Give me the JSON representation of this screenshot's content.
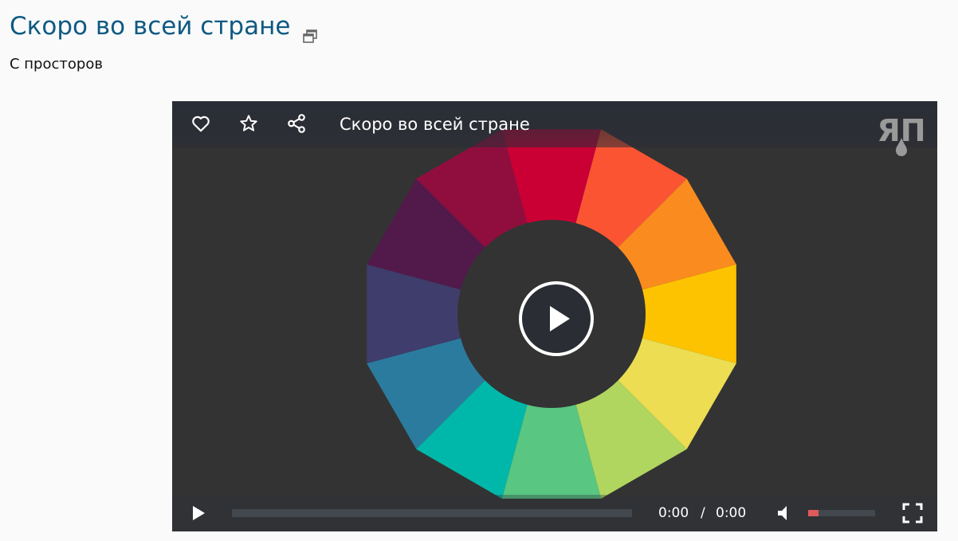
{
  "page": {
    "title": "Скоро во всей стране",
    "subtitle": "С просторов",
    "popout_icon": "popout-window-icon"
  },
  "player": {
    "title": "Скоро во всей стране",
    "logo_text": "ЯП",
    "top_icons": [
      "heart-icon",
      "star-icon",
      "share-icon"
    ],
    "current_time": "0:00",
    "time_separator": "/",
    "duration": "0:00",
    "progress": 0,
    "volume": 0.15,
    "colors": {
      "background": "#333333",
      "accent": "#e05a5a",
      "title_link": "#0e5a83"
    }
  },
  "wheel": {
    "segments": [
      "#ca0035",
      "#fa5433",
      "#fa8b1f",
      "#fdc301",
      "#ecdd52",
      "#b0d65f",
      "#59c681",
      "#00b8a9",
      "#2b7b9f",
      "#3e3d6b",
      "#521a4a",
      "#900e3e"
    ]
  }
}
